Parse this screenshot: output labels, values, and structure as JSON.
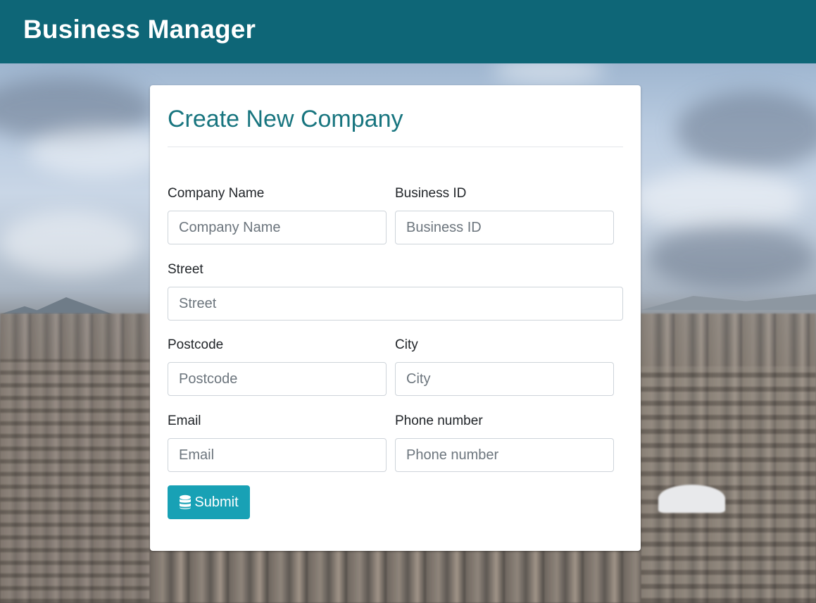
{
  "app": {
    "brand": "Business Manager"
  },
  "form": {
    "title": "Create New Company",
    "fields": {
      "company_name": {
        "label": "Company Name",
        "placeholder": "Company Name",
        "value": ""
      },
      "business_id": {
        "label": "Business ID",
        "placeholder": "Business ID",
        "value": ""
      },
      "street": {
        "label": "Street",
        "placeholder": "Street",
        "value": ""
      },
      "postcode": {
        "label": "Postcode",
        "placeholder": "Postcode",
        "value": ""
      },
      "city": {
        "label": "City",
        "placeholder": "City",
        "value": ""
      },
      "email": {
        "label": "Email",
        "placeholder": "Email",
        "value": ""
      },
      "phone": {
        "label": "Phone number",
        "placeholder": "Phone number",
        "value": ""
      }
    },
    "submit": {
      "label": "Submit",
      "icon": "database-icon"
    }
  },
  "colors": {
    "navbar": "#0e6677",
    "title": "#18757f",
    "submit_button": "#18a1b5"
  }
}
